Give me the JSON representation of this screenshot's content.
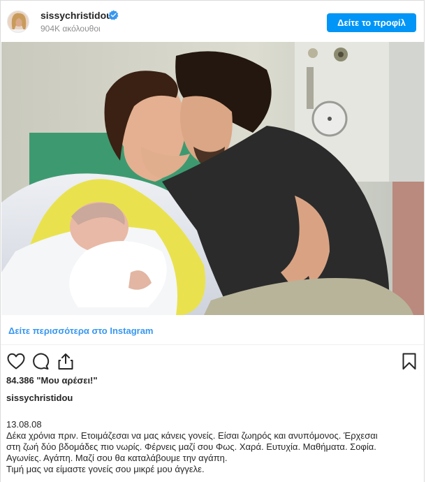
{
  "header": {
    "username": "sissychristidou",
    "followers": "904K ακόλουθοι",
    "profile_button": "Δείτε το προφίλ"
  },
  "icons": {
    "verified": "verified-badge-icon",
    "like": "heart-icon",
    "comment": "comment-icon",
    "share": "share-icon",
    "save": "bookmark-icon"
  },
  "colors": {
    "accent": "#0095f6",
    "link": "#3897f0",
    "verified": "#3897f0"
  },
  "see_more": "Δείτε περισσότερα στο Instagram",
  "likes": "84.386 \"Μου αρέσει!\"",
  "author": "sissychristidou",
  "caption": {
    "date": "13.08.08",
    "lines": [
      "Δέκα χρόνια πριν. Ετοιμάζεσαι να μας κάνεις γονείς. Είσαι ζωηρός και ανυπόμονος. Έρχεσαι",
      "στη ζωή δύο βδομάδες πιο νωρίς. Φέρνεις μαζί σου Φως. Χαρά. Ευτυχία. Μαθήματα. Σοφία.",
      "Αγωνίες. Αγάπη. Μαζί σου θα καταλάβουμε την αγάπη.",
      "Τιμή μας να είμαστε γονείς σου μικρέ μου άγγελε."
    ]
  }
}
